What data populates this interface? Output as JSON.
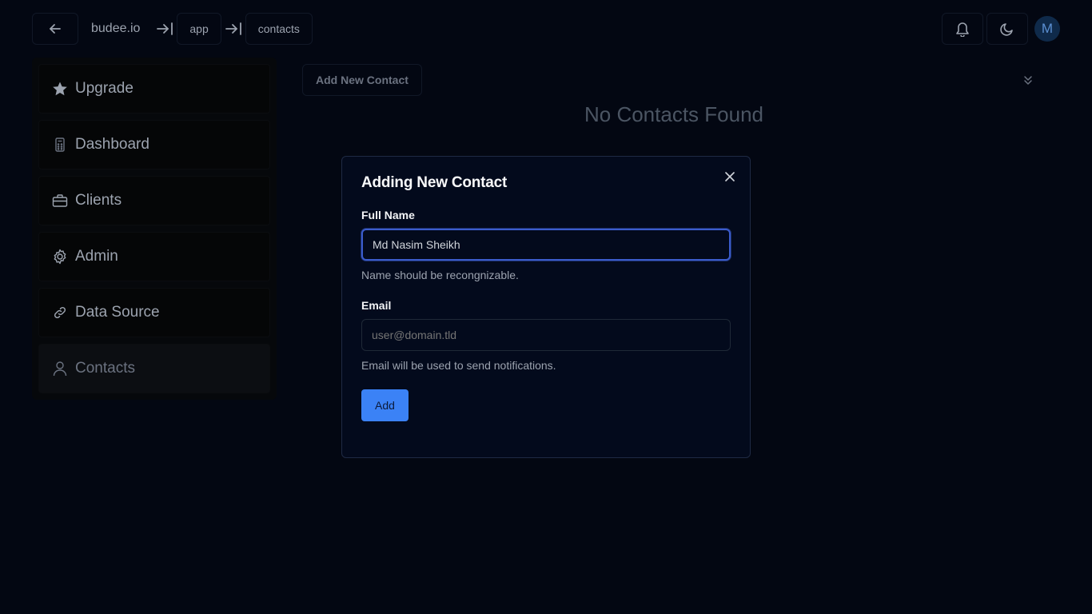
{
  "breadcrumb": {
    "site": "budee.io",
    "items": [
      "app",
      "contacts"
    ]
  },
  "user": {
    "avatar_initial": "M"
  },
  "sidebar": {
    "items": [
      {
        "label": "Upgrade",
        "icon": "star-icon"
      },
      {
        "label": "Dashboard",
        "icon": "calculator-icon"
      },
      {
        "label": "Clients",
        "icon": "briefcase-icon"
      },
      {
        "label": "Admin",
        "icon": "gear-icon"
      },
      {
        "label": "Data Source",
        "icon": "link-icon"
      },
      {
        "label": "Contacts",
        "icon": "user-icon",
        "active": true
      }
    ]
  },
  "main": {
    "add_button_label": "Add New Contact",
    "empty_message": "No Contacts Found"
  },
  "modal": {
    "title": "Adding New Contact",
    "full_name": {
      "label": "Full Name",
      "value": "Md Nasim Sheikh",
      "help": "Name should be recongnizable."
    },
    "email": {
      "label": "Email",
      "placeholder": "user@domain.tld",
      "help": "Email will be used to send notifications."
    },
    "submit_label": "Add"
  },
  "colors": {
    "background": "#030712",
    "accent": "#3b82f6",
    "focus_ring": "#3b5ccc"
  }
}
